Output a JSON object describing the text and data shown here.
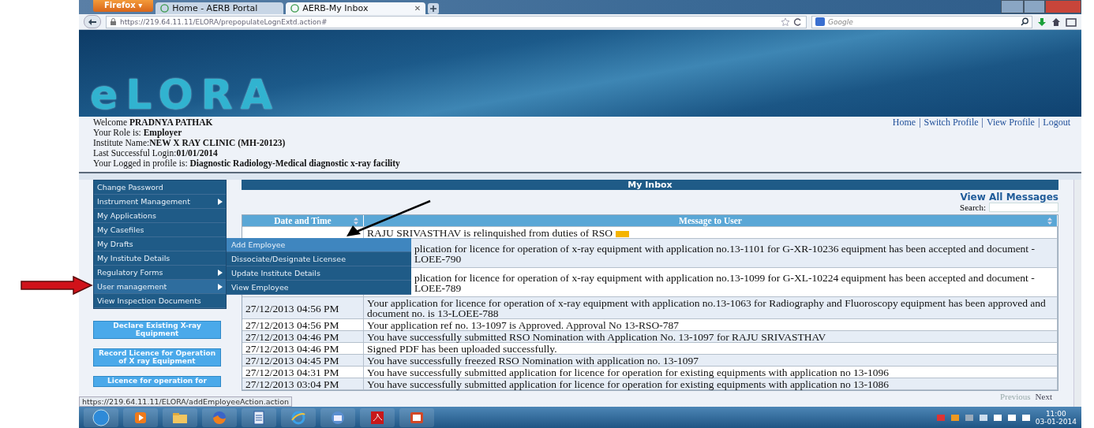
{
  "browser": {
    "menu_button": "Firefox",
    "menu_caret": "▾",
    "tab_close": "✕",
    "tabs": [
      {
        "title": "Home - AERB Portal",
        "selected": false
      },
      {
        "title": "AERB-My Inbox",
        "selected": true
      }
    ],
    "url": "https://219.64.11.11/ELORA/prepopulateLognExtd.action#",
    "search_placeholder": "Google",
    "status_url": "https://219.64.11.11/ELORA/addEmployeeAction.action"
  },
  "logo": "eLORA",
  "user_info": [
    {
      "label": "Welcome ",
      "value": "PRADNYA PATHAK"
    },
    {
      "label": "Your Role is: ",
      "value": "Employer"
    },
    {
      "label": "Institute Name:",
      "value": "NEW X RAY CLINIC (MH-20123)"
    },
    {
      "label": "Last Successful Login:",
      "value": "01/01/2014"
    },
    {
      "label": "Your Logged in profile is: ",
      "value": "Diagnostic Radiology-Medical diagnostic x-ray facility"
    }
  ],
  "header_links": [
    "Home",
    "Switch Profile",
    "View Profile",
    "Logout"
  ],
  "link_separator": "|",
  "sidebar": {
    "items": [
      {
        "label": "Change Password",
        "has_submenu": false,
        "expanded": false
      },
      {
        "label": "Instrument Management",
        "has_submenu": true,
        "expanded": false
      },
      {
        "label": "My Applications",
        "has_submenu": false,
        "expanded": false
      },
      {
        "label": "My Casefiles",
        "has_submenu": false,
        "expanded": false
      },
      {
        "label": "My Drafts",
        "has_submenu": false,
        "expanded": false
      },
      {
        "label": "My Institute Details",
        "has_submenu": false,
        "expanded": false
      },
      {
        "label": "Regulatory Forms",
        "has_submenu": true,
        "expanded": false
      },
      {
        "label": "User management",
        "has_submenu": true,
        "expanded": true
      },
      {
        "label": "View Inspection Documents",
        "has_submenu": false,
        "expanded": false
      }
    ],
    "submenu": [
      {
        "label": "Add Employee",
        "selected": true
      },
      {
        "label": "Dissociate/Designate Licensee",
        "selected": false
      },
      {
        "label": "Update Institute Details",
        "selected": false
      },
      {
        "label": "View Employee",
        "selected": false
      }
    ],
    "action_buttons": [
      "Declare Existing X-ray Equipment",
      "Record Licence for Operation of X ray Equipment",
      "Licence for operation for"
    ]
  },
  "inbox": {
    "title": "My Inbox",
    "view_all": "View All Messages",
    "search_label": "Search:",
    "columns": [
      "Date and Time",
      "Message to User"
    ],
    "rows": [
      {
        "kind": "covered",
        "message": "RAJU SRIVASTHAV is relinquished from duties of RSO",
        "new": true
      },
      {
        "kind": "covered",
        "message": "plication for licence for operation of x-ray equipment with application no.13-1101 for G-XR-10236 equipment has been accepted and document -LOEE-790",
        "new": false
      },
      {
        "kind": "covered",
        "message": "plication for licence for operation of x-ray equipment with application no.13-1099 for G-XL-10224 equipment has been accepted and document -LOEE-789",
        "new": false
      },
      {
        "kind": "full",
        "date": "27/12/2013 04:56 PM",
        "message": "Your application for licence for operation of x-ray equipment with application no.13-1063 for Radiography and Fluoroscopy equipment has been approved and document no. is 13-LOEE-788",
        "new": false
      },
      {
        "kind": "full",
        "date": "27/12/2013 04:56 PM",
        "message": "Your application ref no. 13-1097 is Approved. Approval No 13-RSO-787",
        "new": false
      },
      {
        "kind": "full",
        "date": "27/12/2013 04:46 PM",
        "message": "You have successfully submitted RSO Nomination with Application No. 13-1097 for RAJU SRIVASTHAV",
        "new": false
      },
      {
        "kind": "full",
        "date": "27/12/2013 04:46 PM",
        "message": "Signed PDF has been uploaded successfully.",
        "new": false
      },
      {
        "kind": "full",
        "date": "27/12/2013 04:45 PM",
        "message": "You have successfully freezed RSO Nomination with application no. 13-1097",
        "new": false
      },
      {
        "kind": "full",
        "date": "27/12/2013 04:31 PM",
        "message": "You have successfully submitted application for licence for operation for existing equipments with application no 13-1096",
        "new": false
      },
      {
        "kind": "full",
        "date": "27/12/2013 03:04 PM",
        "message": "You have successfully submitted application for licence for operation for existing equipments with application no 13-1086",
        "new": false
      }
    ],
    "pagination": [
      "Previous",
      "Next"
    ]
  },
  "taskbar": {
    "time": "11:00",
    "date": "03-01-2014"
  }
}
